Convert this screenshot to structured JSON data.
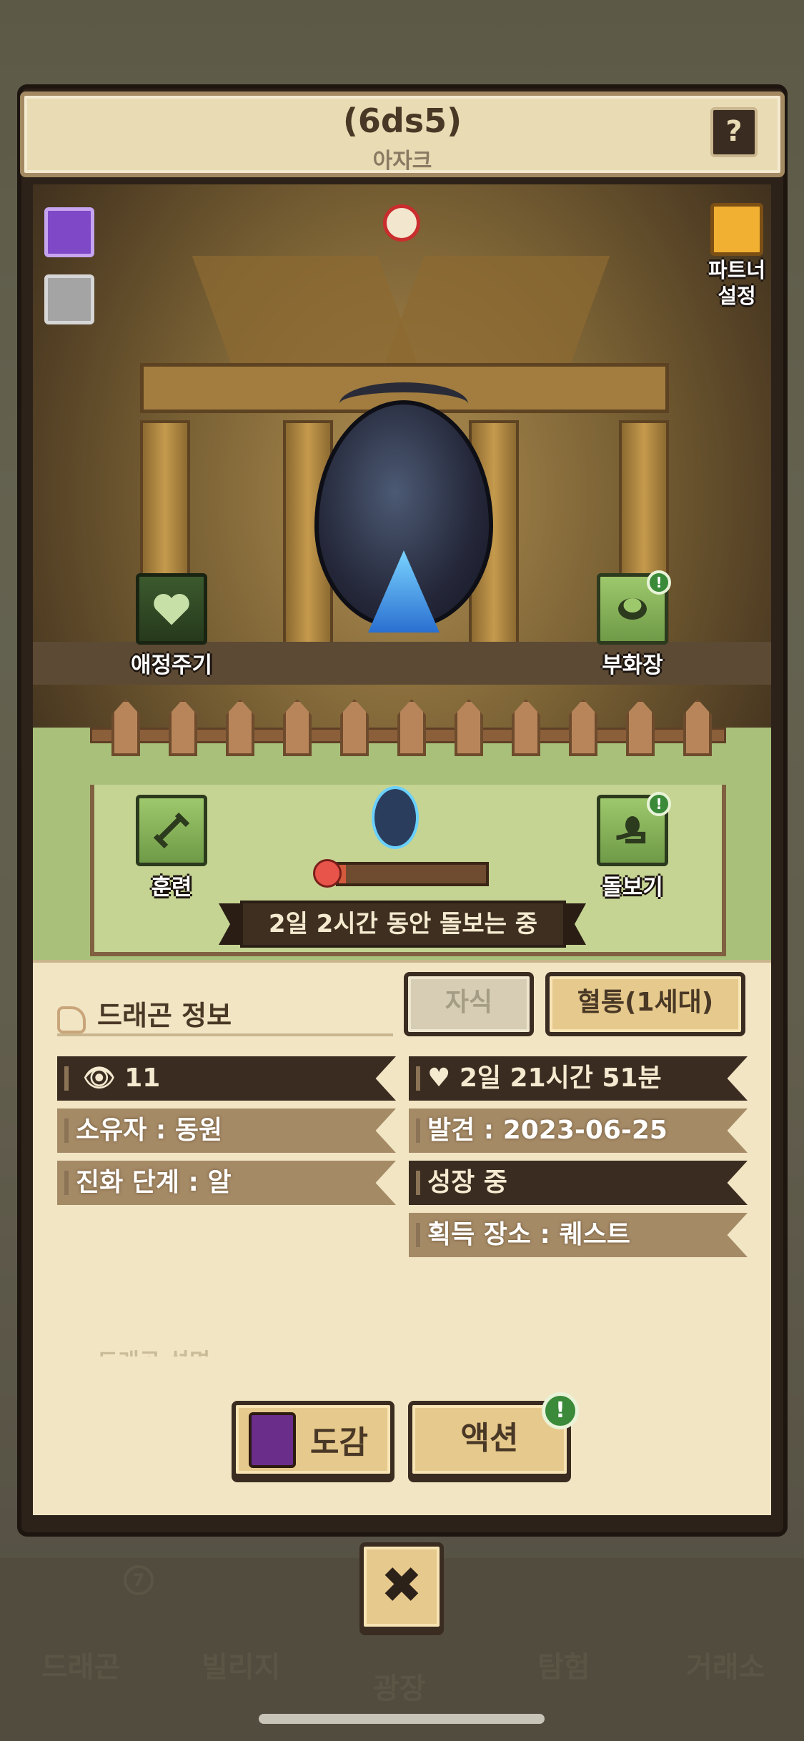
{
  "header": {
    "title": "(6ds5)",
    "subtitle": "아자크",
    "help_label": "?"
  },
  "scene": {
    "partner_label": "파트너\n설정",
    "actions": {
      "affection": "애정주기",
      "hatchery": "부화장",
      "training": "훈련",
      "care": "돌보기"
    },
    "mood_level": 0.05,
    "status": "2일 2시간 동안 돌보는 중"
  },
  "info": {
    "title": "드래곤 정보",
    "tabs": {
      "child": "자식",
      "bloodline": "혈통(1세대)"
    },
    "left": {
      "views": "11",
      "owner": "소유자 : 동원",
      "stage": "진화 단계 : 알"
    },
    "right": {
      "age": "2일 21시간 51분",
      "found": "발견 : 2023-06-25",
      "growth": "성장 중",
      "origin": "획득 장소 : 퀘스트"
    },
    "description_peek": "드래곤 설명"
  },
  "buttons": {
    "dex": "도감",
    "action": "액션",
    "action_badge": "!",
    "close": "✖"
  },
  "background": {
    "tabs": [
      "드래곤",
      "빌리지",
      "광장",
      "탐험",
      "거래소"
    ],
    "badge": "7"
  },
  "colors": {
    "frame": "#2d2219",
    "panel": "#f1e5c4",
    "accent_green": "#3a8a3a",
    "button": "#e6c98c"
  }
}
